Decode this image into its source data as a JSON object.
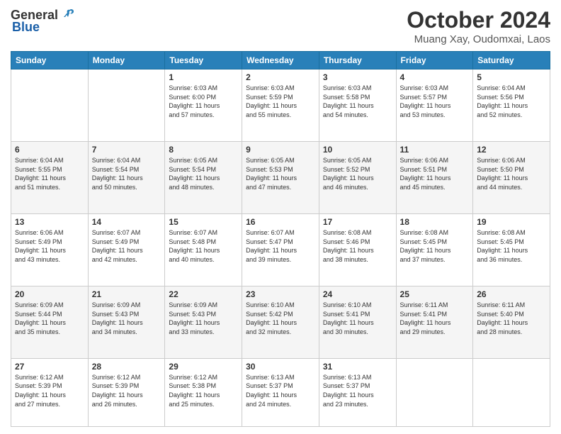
{
  "header": {
    "logo": {
      "general": "General",
      "blue": "Blue"
    },
    "title": "October 2024",
    "location": "Muang Xay, Oudomxai, Laos"
  },
  "weekdays": [
    "Sunday",
    "Monday",
    "Tuesday",
    "Wednesday",
    "Thursday",
    "Friday",
    "Saturday"
  ],
  "weeks": [
    [
      {
        "day": "",
        "info": ""
      },
      {
        "day": "",
        "info": ""
      },
      {
        "day": "1",
        "info": "Sunrise: 6:03 AM\nSunset: 6:00 PM\nDaylight: 11 hours\nand 57 minutes."
      },
      {
        "day": "2",
        "info": "Sunrise: 6:03 AM\nSunset: 5:59 PM\nDaylight: 11 hours\nand 55 minutes."
      },
      {
        "day": "3",
        "info": "Sunrise: 6:03 AM\nSunset: 5:58 PM\nDaylight: 11 hours\nand 54 minutes."
      },
      {
        "day": "4",
        "info": "Sunrise: 6:03 AM\nSunset: 5:57 PM\nDaylight: 11 hours\nand 53 minutes."
      },
      {
        "day": "5",
        "info": "Sunrise: 6:04 AM\nSunset: 5:56 PM\nDaylight: 11 hours\nand 52 minutes."
      }
    ],
    [
      {
        "day": "6",
        "info": "Sunrise: 6:04 AM\nSunset: 5:55 PM\nDaylight: 11 hours\nand 51 minutes."
      },
      {
        "day": "7",
        "info": "Sunrise: 6:04 AM\nSunset: 5:54 PM\nDaylight: 11 hours\nand 50 minutes."
      },
      {
        "day": "8",
        "info": "Sunrise: 6:05 AM\nSunset: 5:54 PM\nDaylight: 11 hours\nand 48 minutes."
      },
      {
        "day": "9",
        "info": "Sunrise: 6:05 AM\nSunset: 5:53 PM\nDaylight: 11 hours\nand 47 minutes."
      },
      {
        "day": "10",
        "info": "Sunrise: 6:05 AM\nSunset: 5:52 PM\nDaylight: 11 hours\nand 46 minutes."
      },
      {
        "day": "11",
        "info": "Sunrise: 6:06 AM\nSunset: 5:51 PM\nDaylight: 11 hours\nand 45 minutes."
      },
      {
        "day": "12",
        "info": "Sunrise: 6:06 AM\nSunset: 5:50 PM\nDaylight: 11 hours\nand 44 minutes."
      }
    ],
    [
      {
        "day": "13",
        "info": "Sunrise: 6:06 AM\nSunset: 5:49 PM\nDaylight: 11 hours\nand 43 minutes."
      },
      {
        "day": "14",
        "info": "Sunrise: 6:07 AM\nSunset: 5:49 PM\nDaylight: 11 hours\nand 42 minutes."
      },
      {
        "day": "15",
        "info": "Sunrise: 6:07 AM\nSunset: 5:48 PM\nDaylight: 11 hours\nand 40 minutes."
      },
      {
        "day": "16",
        "info": "Sunrise: 6:07 AM\nSunset: 5:47 PM\nDaylight: 11 hours\nand 39 minutes."
      },
      {
        "day": "17",
        "info": "Sunrise: 6:08 AM\nSunset: 5:46 PM\nDaylight: 11 hours\nand 38 minutes."
      },
      {
        "day": "18",
        "info": "Sunrise: 6:08 AM\nSunset: 5:45 PM\nDaylight: 11 hours\nand 37 minutes."
      },
      {
        "day": "19",
        "info": "Sunrise: 6:08 AM\nSunset: 5:45 PM\nDaylight: 11 hours\nand 36 minutes."
      }
    ],
    [
      {
        "day": "20",
        "info": "Sunrise: 6:09 AM\nSunset: 5:44 PM\nDaylight: 11 hours\nand 35 minutes."
      },
      {
        "day": "21",
        "info": "Sunrise: 6:09 AM\nSunset: 5:43 PM\nDaylight: 11 hours\nand 34 minutes."
      },
      {
        "day": "22",
        "info": "Sunrise: 6:09 AM\nSunset: 5:43 PM\nDaylight: 11 hours\nand 33 minutes."
      },
      {
        "day": "23",
        "info": "Sunrise: 6:10 AM\nSunset: 5:42 PM\nDaylight: 11 hours\nand 32 minutes."
      },
      {
        "day": "24",
        "info": "Sunrise: 6:10 AM\nSunset: 5:41 PM\nDaylight: 11 hours\nand 30 minutes."
      },
      {
        "day": "25",
        "info": "Sunrise: 6:11 AM\nSunset: 5:41 PM\nDaylight: 11 hours\nand 29 minutes."
      },
      {
        "day": "26",
        "info": "Sunrise: 6:11 AM\nSunset: 5:40 PM\nDaylight: 11 hours\nand 28 minutes."
      }
    ],
    [
      {
        "day": "27",
        "info": "Sunrise: 6:12 AM\nSunset: 5:39 PM\nDaylight: 11 hours\nand 27 minutes."
      },
      {
        "day": "28",
        "info": "Sunrise: 6:12 AM\nSunset: 5:39 PM\nDaylight: 11 hours\nand 26 minutes."
      },
      {
        "day": "29",
        "info": "Sunrise: 6:12 AM\nSunset: 5:38 PM\nDaylight: 11 hours\nand 25 minutes."
      },
      {
        "day": "30",
        "info": "Sunrise: 6:13 AM\nSunset: 5:37 PM\nDaylight: 11 hours\nand 24 minutes."
      },
      {
        "day": "31",
        "info": "Sunrise: 6:13 AM\nSunset: 5:37 PM\nDaylight: 11 hours\nand 23 minutes."
      },
      {
        "day": "",
        "info": ""
      },
      {
        "day": "",
        "info": ""
      }
    ]
  ]
}
